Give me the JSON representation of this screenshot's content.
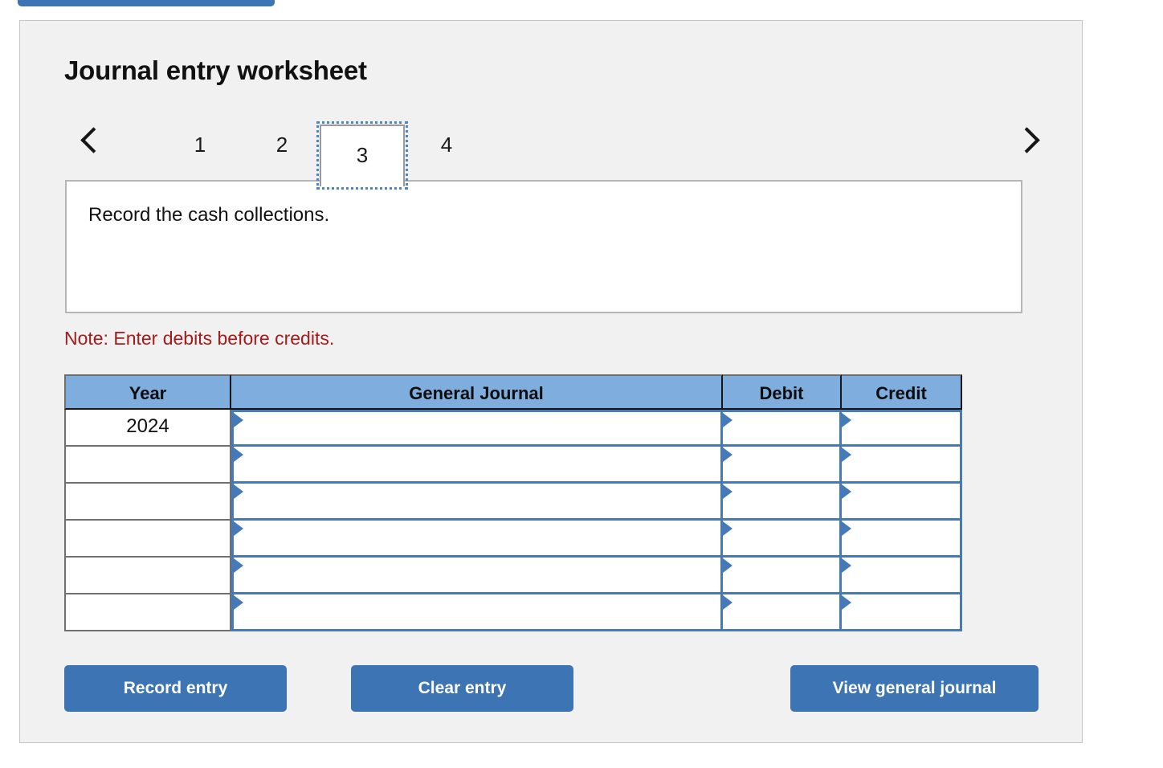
{
  "top_bar": {
    "present": true,
    "color": "#3C74B4"
  },
  "card": {
    "title": "Journal entry worksheet",
    "background": "#F1F1F1",
    "border_color": "#C6C6C6"
  },
  "tabs": {
    "prev_icon": "chevron-left-icon",
    "next_icon": "chevron-right-icon",
    "active_index": 2,
    "items": [
      {
        "label": "1",
        "active": false
      },
      {
        "label": "2",
        "active": false
      },
      {
        "label": "3",
        "active": true
      },
      {
        "label": "4",
        "active": false
      }
    ]
  },
  "prompt": {
    "text": "Record the cash collections."
  },
  "note": {
    "text": "Note: Enter debits before credits.",
    "color": "#A51A1A"
  },
  "table": {
    "header_color": "#7FADDE",
    "input_border_color": "#4579B8",
    "columns": [
      "Year",
      "General Journal",
      "Debit",
      "Credit"
    ],
    "rows": [
      {
        "year": "2024",
        "general_journal": "",
        "debit": "",
        "credit": ""
      },
      {
        "year": "",
        "general_journal": "",
        "debit": "",
        "credit": ""
      },
      {
        "year": "",
        "general_journal": "",
        "debit": "",
        "credit": ""
      },
      {
        "year": "",
        "general_journal": "",
        "debit": "",
        "credit": ""
      },
      {
        "year": "",
        "general_journal": "",
        "debit": "",
        "credit": ""
      },
      {
        "year": "",
        "general_journal": "",
        "debit": "",
        "credit": ""
      }
    ]
  },
  "buttons": {
    "record": "Record entry",
    "clear": "Clear entry",
    "view": "View general journal",
    "color": "#3C74B4"
  }
}
